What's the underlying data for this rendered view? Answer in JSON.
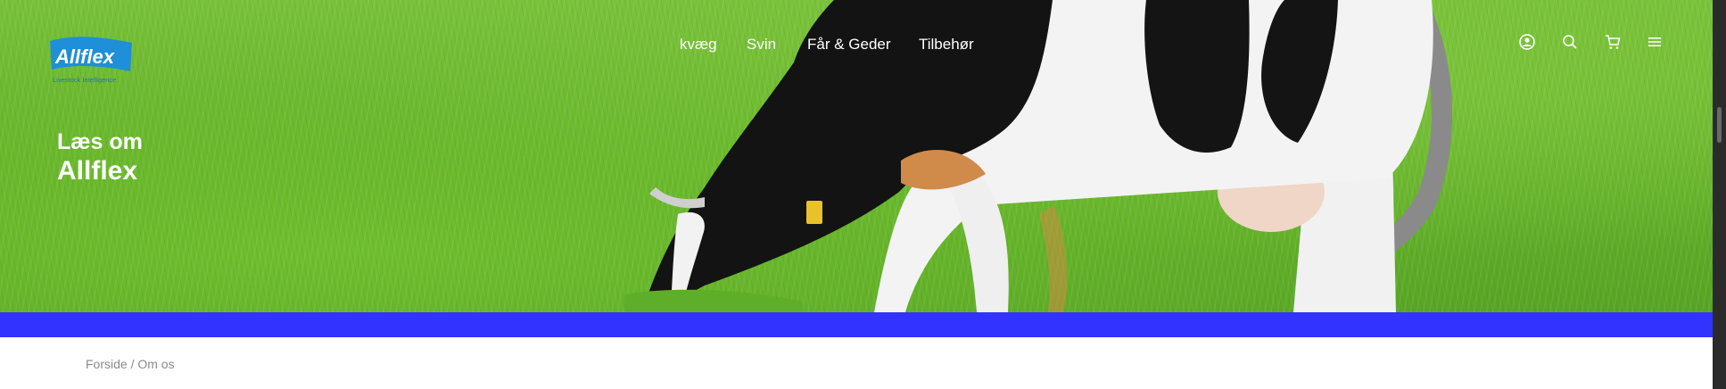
{
  "brand": {
    "name": "Allflex",
    "tagline": "Livestock Intelligence",
    "accent_color": "#3333ff"
  },
  "nav": {
    "items": [
      {
        "label": "kvæg"
      },
      {
        "label": "Svin"
      },
      {
        "label": "Får & Geder"
      },
      {
        "label": "Tilbehør"
      }
    ]
  },
  "header_icons": [
    "user-icon",
    "search-icon",
    "cart-icon",
    "menu-icon"
  ],
  "hero": {
    "line1": "Læs om",
    "line2": "Allflex"
  },
  "breadcrumb": {
    "home": "Forside",
    "separator": " / ",
    "current": "Om os"
  }
}
